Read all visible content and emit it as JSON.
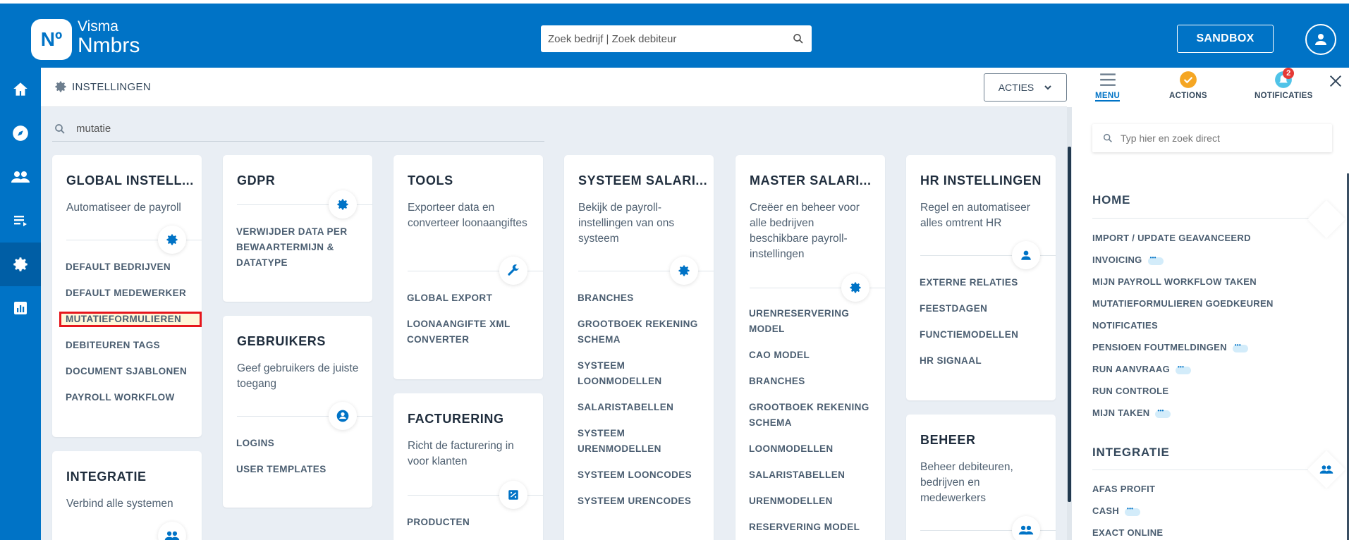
{
  "header": {
    "logo_mark": "Nº",
    "logo_line1": "Visma",
    "logo_line2": "Nmbrs",
    "search_placeholder": "Zoek bedrijf | Zoek debiteur",
    "sandbox_label": "SANDBOX"
  },
  "leftnav": {
    "items": [
      "home-icon",
      "compass-icon",
      "people-icon",
      "list-icon",
      "gear-icon",
      "chart-icon"
    ],
    "active_index": 4
  },
  "subheader": {
    "title": "INSTELLINGEN",
    "actions_label": "ACTIES"
  },
  "filter": {
    "value": "mutatie"
  },
  "cards": {
    "global": {
      "title": "GLOBAL INSTELL...",
      "desc": "Automatiseer de payroll",
      "links": [
        "DEFAULT BEDRIJVEN",
        "DEFAULT MEDEWERKER",
        "MUTATIEFORMULIEREN",
        "DEBITEUREN TAGS",
        "DOCUMENT SJABLONEN",
        "PAYROLL WORKFLOW"
      ],
      "highlighted_index": 2
    },
    "integratie": {
      "title": "INTEGRATIE",
      "desc": "Verbind alle systemen"
    },
    "gdpr": {
      "title": "GDPR",
      "links": [
        "VERWIJDER DATA PER BEWAARTERMIJN & DATATYPE"
      ]
    },
    "gebruikers": {
      "title": "GEBRUIKERS",
      "desc": "Geef gebruikers de juiste toegang",
      "links": [
        "LOGINS",
        "USER TEMPLATES"
      ]
    },
    "tools": {
      "title": "TOOLS",
      "desc": "Exporteer data en converteer loonaangiftes",
      "links": [
        "GLOBAL EXPORT",
        "LOONAANGIFTE XML CONVERTER"
      ]
    },
    "facturering": {
      "title": "FACTURERING",
      "desc": "Richt de facturering in voor klanten",
      "links": [
        "PRODUCTEN"
      ]
    },
    "systeem": {
      "title": "SYSTEEM SALARI...",
      "desc": "Bekijk de payroll-instellingen van ons systeem",
      "links": [
        "BRANCHES",
        "GROOTBOEK REKENING SCHEMA",
        "SYSTEEM LOONMODELLEN",
        "SALARISTABELLEN",
        "SYSTEEM URENMODELLEN",
        "SYSTEEM LOONCODES",
        "SYSTEEM URENCODES"
      ]
    },
    "master": {
      "title": "MASTER SALARI...",
      "desc": "Creëer en beheer voor alle bedrijven beschikbare payroll-instellingen",
      "links": [
        "URENRESERVERING MODEL",
        "CAO MODEL",
        "BRANCHES",
        "GROOTBOEK REKENING SCHEMA",
        "LOONMODELLEN",
        "SALARISTABELLEN",
        "URENMODELLEN",
        "RESERVERING MODEL"
      ]
    },
    "hr": {
      "title": "HR INSTELLINGEN",
      "desc": "Regel en automatiseer alles omtrent HR",
      "links": [
        "EXTERNE RELATIES",
        "FEESTDAGEN",
        "FUNCTIEMODELLEN",
        "HR SIGNAAL"
      ]
    },
    "beheer": {
      "title": "BEHEER",
      "desc": "Beheer debiteuren, bedrijven en medewerkers"
    }
  },
  "rpanel": {
    "tabs": {
      "menu": "MENU",
      "actions": "ACTIONS",
      "notifications": "NOTIFICATIES"
    },
    "notification_count": "2",
    "search_placeholder": "Typ hier en zoek direct",
    "home": {
      "title": "HOME",
      "items": [
        {
          "label": "IMPORT / UPDATE GEAVANCEERD",
          "dots": false
        },
        {
          "label": "INVOICING",
          "dots": true
        },
        {
          "label": "MIJN PAYROLL WORKFLOW TAKEN",
          "dots": false
        },
        {
          "label": "MUTATIEFORMULIEREN GOEDKEUREN",
          "dots": false
        },
        {
          "label": "NOTIFICATIES",
          "dots": false
        },
        {
          "label": "PENSIOEN FOUTMELDINGEN",
          "dots": true
        },
        {
          "label": "RUN AANVRAAG",
          "dots": true
        },
        {
          "label": "RUN CONTROLE",
          "dots": false
        },
        {
          "label": "MIJN TAKEN",
          "dots": true
        }
      ]
    },
    "integratie": {
      "title": "INTEGRATIE",
      "items": [
        {
          "label": "AFAS PROFIT",
          "dots": false
        },
        {
          "label": "CASH",
          "dots": true
        },
        {
          "label": "EXACT ONLINE",
          "dots": false
        }
      ]
    }
  },
  "colors": {
    "brand": "#0073c6",
    "highlight_border": "#e6161c",
    "badge_check": "#f5a623",
    "badge_notif": "#e53935"
  }
}
